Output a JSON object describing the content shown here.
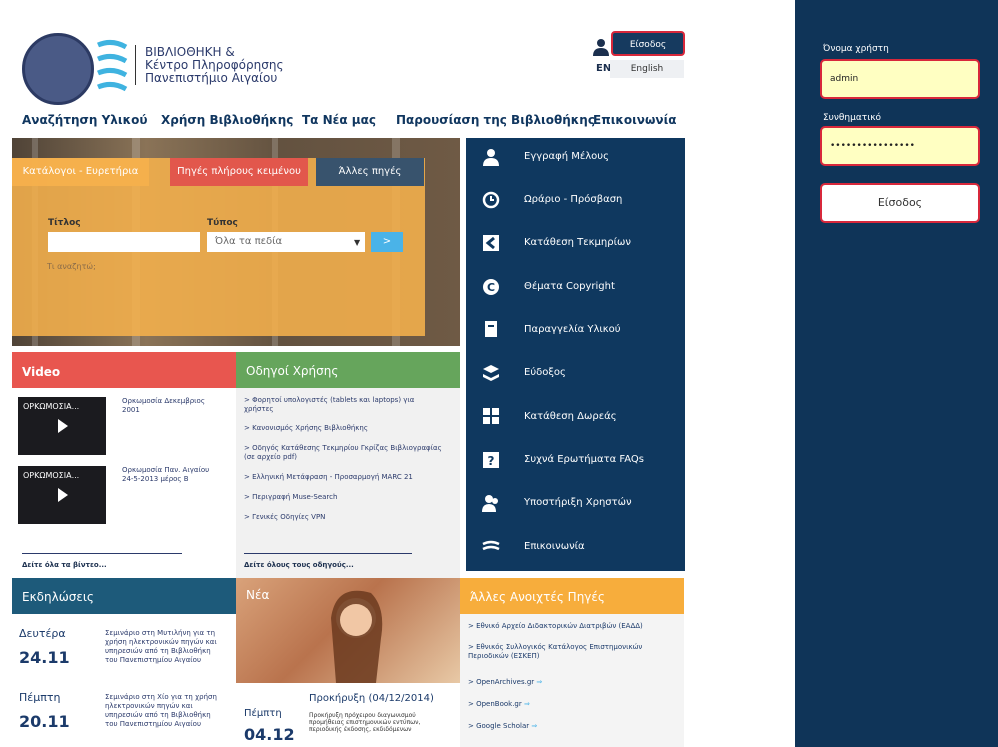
{
  "header": {
    "logo_line1": "ΒΙΒΛΙΟΘΗΚΗ &",
    "logo_line2": "Κέντρο Πληροφόρησης",
    "logo_line3": "Πανεπιστήμιο Αιγαίου",
    "login_label": "Είσοδος",
    "lang_code": "EN",
    "lang_label": "English"
  },
  "nav": [
    "Αναζήτηση Υλικού",
    "Χρήση Βιβλιοθήκης",
    "Τα Νέα μας",
    "Παρουσίαση της Βιβλιοθήκης",
    "Επικοινωνία"
  ],
  "search": {
    "tabs": [
      "Κατάλογοι - Ευρετήρια",
      "Πηγές πλήρους κειμένου",
      "Άλλες πηγές"
    ],
    "title_label": "Τίτλος",
    "type_label": "Τύπος",
    "type_selected": "Όλα τα πεδία",
    "go_label": ">",
    "hint": "Τι αναζητώ;"
  },
  "menu": [
    "Εγγραφή Μέλους",
    "Ωράριο - Πρόσβαση",
    "Κατάθεση Τεκμηρίων",
    "Θέματα Copyright",
    "Παραγγελία Υλικού",
    "Εύδοξος",
    "Κατάθεση Δωρεάς",
    "Συχνά Ερωτήματα FAQs",
    "Υποστήριξη Χρηστών",
    "Επικοινωνία"
  ],
  "video": {
    "title": "Video",
    "items": [
      {
        "thumb": "ΟΡΚΩΜΟΣΙΑ...",
        "caption": "Ορκωμοσία Δεκεμβριος 2001"
      },
      {
        "thumb": "ΟΡΚΩΜΟΣΙΑ...",
        "caption": "Ορκωμοσία Παν. Αιγαίου 24-5-2013 μέρος Β"
      }
    ],
    "see_all": "Δείτε όλα τα βίντεο..."
  },
  "guides": {
    "title": "Οδηγοί Χρήσης",
    "items": [
      "Φορητοί υπολογιστές (tablets και laptops) για χρήστες",
      "Κανονισμός Χρήσης Βιβλιοθήκης",
      "Οδηγός Κατάθεσης Τεκμηρίου Γκρίζας Βιβλιογραφίας (σε αρχείο pdf)",
      "Ελληνική Μετάφραση - Προσαρμογή MARC 21",
      "Περιγραφή Muse-Search",
      "Γενικές Οδηγίες VPN"
    ],
    "see_all": "Δείτε όλους τους οδηγούς..."
  },
  "events": {
    "title": "Εκδηλώσεις",
    "items": [
      {
        "day": "Δευτέρα",
        "date": "24.11",
        "text": "Σεμινάριο στη Μυτιλήνη για τη χρήση ηλεκτρονικών πηγών και υπηρεσιών από τη Βιβλιοθήκη του Πανεπιστημίου Αιγαίου"
      },
      {
        "day": "Πέμπτη",
        "date": "20.11",
        "text": "Σεμινάριο στη Χίο για τη χρήση ηλεκτρονικών πηγών και υπηρεσιών από τη Βιβλιοθήκη του Πανεπιστημίου Αιγαίου"
      }
    ]
  },
  "news": {
    "title": "Νέα",
    "day": "Πέμπτη",
    "date": "04.12",
    "item_title": "Προκήρυξη (04/12/2014)",
    "item_text": "Προκήρυξη πρόχειρου διαγωνισμού προμήθειας επιστημονικών εντύπων, περιοδικής έκδοσης, εκδιδόμενων"
  },
  "open": {
    "title": "Άλλες Ανοιχτές Πηγές",
    "items": [
      "Εθνικό Αρχείο Διδακτορικών Διατριβών (ΕΑΔΔ)",
      "Εθνικός Συλλογικός Κατάλογος Επιστημονικών Περιοδικών (ΕΣΚΕΠ)",
      "OpenArchives.gr",
      "OpenBook.gr",
      "Google Scholar"
    ]
  },
  "login_panel": {
    "username_label": "Όνομα χρήστη",
    "username_value": "admin",
    "password_label": "Συνθηματικό",
    "password_value": "••••••••••••••••",
    "submit_label": "Είσοδος"
  },
  "colors": {
    "navy": "#0f385f",
    "accent_red": "#d8283b",
    "video_red": "#e8564f",
    "guides_green": "#66a55c",
    "open_orange": "#f7ad3c"
  }
}
